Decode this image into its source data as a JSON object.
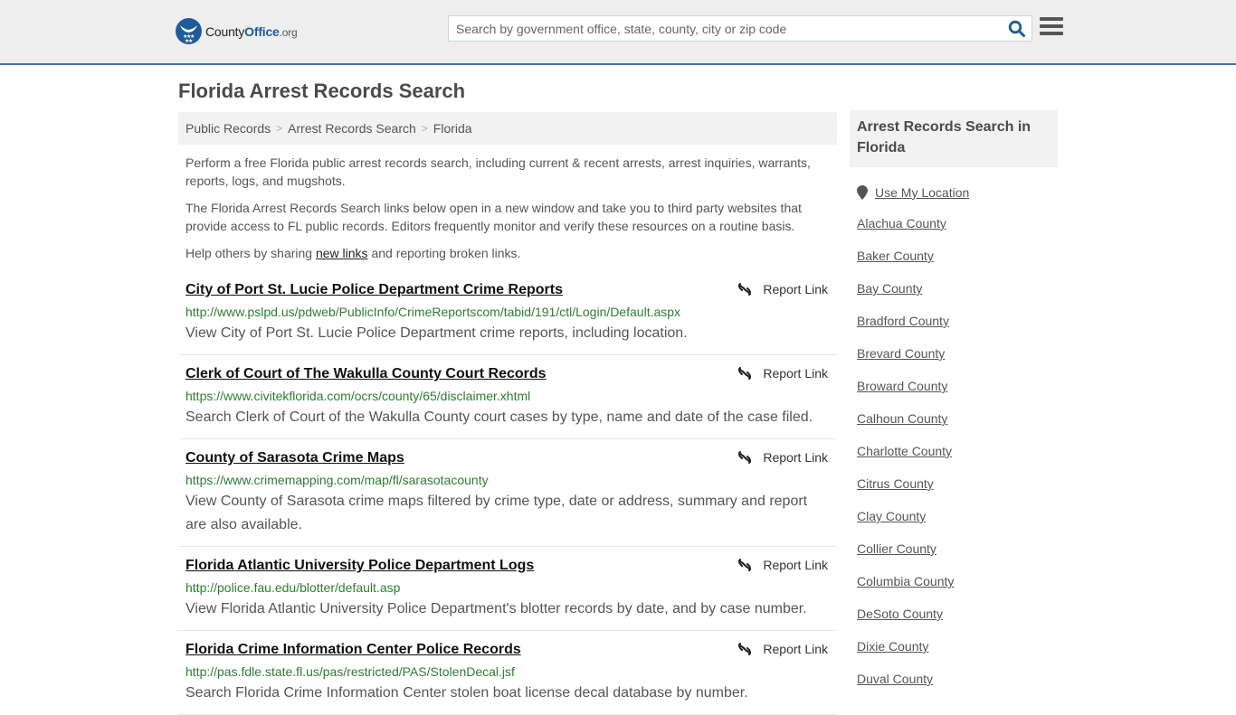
{
  "header": {
    "logo": {
      "county": "County",
      "office": "Office",
      "org": ".org"
    },
    "search_placeholder": "Search by government office, state, county, city or zip code",
    "search_value": ""
  },
  "page": {
    "title": "Florida Arrest Records Search",
    "breadcrumb": [
      "Public Records",
      "Arrest Records Search",
      "Florida"
    ],
    "breadcrumb_separator": ">",
    "intro": {
      "p1": "Perform a free Florida public arrest records search, including current & recent arrests, arrest inquiries, warrants, reports, logs, and mugshots.",
      "p2": "The Florida Arrest Records Search links below open in a new window and take you to third party websites that provide access to FL public records. Editors frequently monitor and verify these resources on a routine basis.",
      "p3_prefix": "Help others by sharing ",
      "p3_link": "new links",
      "p3_suffix": " and reporting broken links."
    }
  },
  "results": [
    {
      "title": "City of Port St. Lucie Police Department Crime Reports",
      "url": "http://www.pslpd.us/pdweb/PublicInfo/CrimeReportscom/tabid/191/ctl/Login/Default.aspx",
      "description": "View City of Port St. Lucie Police Department crime reports, including location.",
      "report_label": "Report Link"
    },
    {
      "title": "Clerk of Court of The Wakulla County Court Records",
      "url": "https://www.civitekflorida.com/ocrs/county/65/disclaimer.xhtml",
      "description": "Search Clerk of Court of the Wakulla County court cases by type, name and date of the case filed.",
      "report_label": "Report Link"
    },
    {
      "title": "County of Sarasota Crime Maps",
      "url": "https://www.crimemapping.com/map/fl/sarasotacounty",
      "description": "View County of Sarasota crime maps filtered by crime type, date or address, summary and report are also available.",
      "report_label": "Report Link"
    },
    {
      "title": "Florida Atlantic University Police Department Logs",
      "url": "http://police.fau.edu/blotter/default.asp",
      "description": "View Florida Atlantic University Police Department's blotter records by date, and by case number.",
      "report_label": "Report Link"
    },
    {
      "title": "Florida Crime Information Center Police Records",
      "url": "http://pas.fdle.state.fl.us/pas/restricted/PAS/StolenDecal.jsf",
      "description": "Search Florida Crime Information Center stolen boat license decal database by number.",
      "report_label": "Report Link"
    }
  ],
  "sidebar": {
    "title": "Arrest Records Search in Florida",
    "use_location": "Use My Location",
    "counties": [
      "Alachua County",
      "Baker County",
      "Bay County",
      "Bradford County",
      "Brevard County",
      "Broward County",
      "Calhoun County",
      "Charlotte County",
      "Citrus County",
      "Clay County",
      "Collier County",
      "Columbia County",
      "DeSoto County",
      "Dixie County",
      "Duval County"
    ]
  },
  "colors": {
    "brand_blue": "#1f5c99",
    "header_border": "#3b74a8",
    "url_green": "#2e7d32"
  }
}
